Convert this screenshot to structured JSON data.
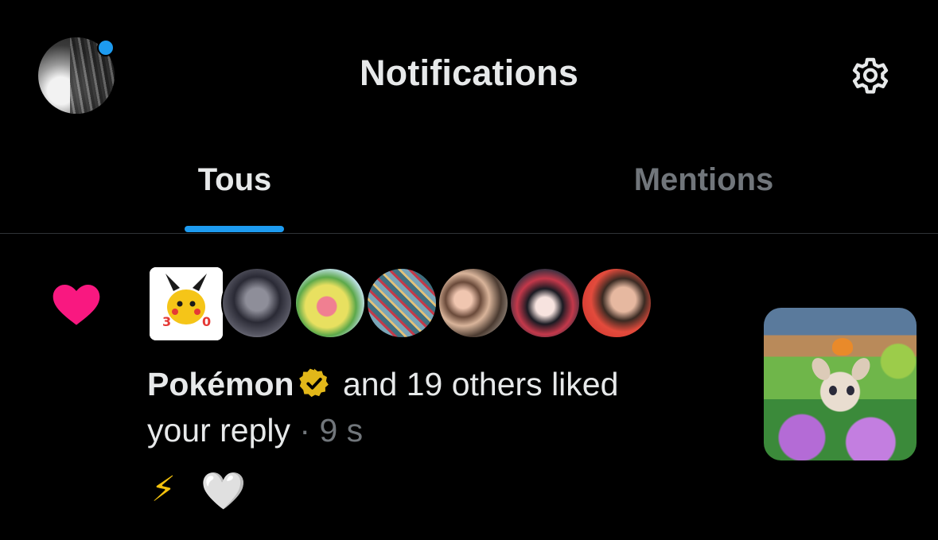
{
  "header": {
    "title": "Notifications",
    "profile_avatar": "profile-photo",
    "unread_indicator": true,
    "settings_icon": "gear-icon"
  },
  "tabs": [
    {
      "label": "Tous",
      "active": true
    },
    {
      "label": "Mentions",
      "active": false
    }
  ],
  "notification": {
    "type_icon": "heart-icon",
    "avatars": [
      "pokemon-30-logo",
      "user-avatar-2",
      "user-avatar-3",
      "user-avatar-4",
      "user-avatar-5",
      "user-avatar-6",
      "user-avatar-7"
    ],
    "name": "Pokémon",
    "verified": true,
    "text_after_name": " and 19 others liked",
    "text_line2": "your reply",
    "separator": " · ",
    "time": "9 s",
    "reply_excerpt": [
      "⚡",
      "🤍"
    ],
    "thumbnail": "post-image"
  },
  "colors": {
    "accent": "#1d9bf0",
    "heart": "#f91880",
    "verified_gold": "#e2b719",
    "secondary_text": "#71767b",
    "primary_text": "#e7e9ea"
  }
}
